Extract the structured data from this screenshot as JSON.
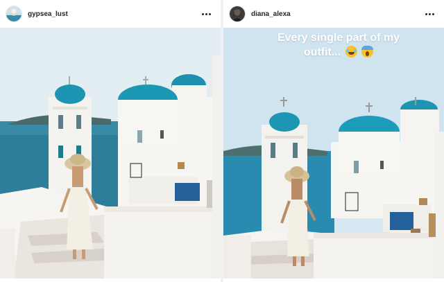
{
  "posts": [
    {
      "username": "gypsea_lust",
      "more_icon": "more-horizontal-icon",
      "caption_overlay": ""
    },
    {
      "username": "diana_alexa",
      "more_icon": "more-horizontal-icon",
      "caption_overlay": "Every single part of my outfit..."
    }
  ],
  "colors": {
    "sky": "#dcecf3",
    "sea": "#2f7e9c",
    "dome": "#1f9bb8",
    "wall": "#f6f4f1"
  }
}
